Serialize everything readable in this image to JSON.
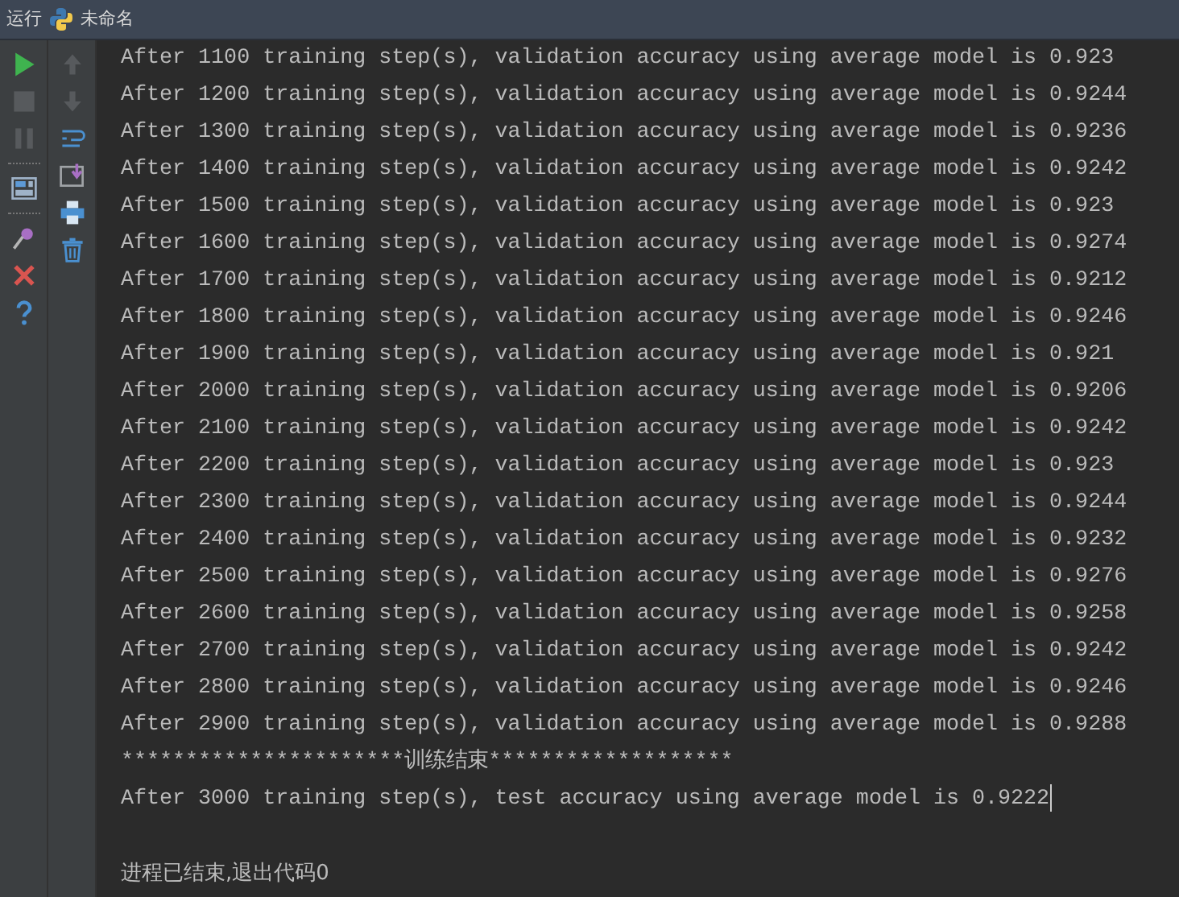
{
  "title_bar": {
    "label": "运行",
    "config_name": "未命名"
  },
  "toolbar_left": [
    {
      "kind": "run",
      "disabled": false
    },
    {
      "kind": "stop",
      "disabled": true
    },
    {
      "kind": "pause",
      "disabled": true
    },
    {
      "kind": "sep"
    },
    {
      "kind": "layout",
      "disabled": false
    },
    {
      "kind": "sep"
    },
    {
      "kind": "pin",
      "disabled": false
    },
    {
      "kind": "close",
      "disabled": false
    },
    {
      "kind": "help",
      "disabled": false
    }
  ],
  "toolbar_right": [
    {
      "kind": "up",
      "disabled": true
    },
    {
      "kind": "down",
      "disabled": true
    },
    {
      "kind": "wrap",
      "disabled": false
    },
    {
      "kind": "scroll-end",
      "disabled": false
    },
    {
      "kind": "print",
      "disabled": false
    },
    {
      "kind": "trash",
      "disabled": false
    }
  ],
  "console": {
    "lines": [
      "After 1100 training step(s), validation accuracy using average model is 0.923",
      "After 1200 training step(s), validation accuracy using average model is 0.9244",
      "After 1300 training step(s), validation accuracy using average model is 0.9236",
      "After 1400 training step(s), validation accuracy using average model is 0.9242",
      "After 1500 training step(s), validation accuracy using average model is 0.923",
      "After 1600 training step(s), validation accuracy using average model is 0.9274",
      "After 1700 training step(s), validation accuracy using average model is 0.9212",
      "After 1800 training step(s), validation accuracy using average model is 0.9246",
      "After 1900 training step(s), validation accuracy using average model is 0.921",
      "After 2000 training step(s), validation accuracy using average model is 0.9206",
      "After 2100 training step(s), validation accuracy using average model is 0.9242",
      "After 2200 training step(s), validation accuracy using average model is 0.923",
      "After 2300 training step(s), validation accuracy using average model is 0.9244",
      "After 2400 training step(s), validation accuracy using average model is 0.9232",
      "After 2500 training step(s), validation accuracy using average model is 0.9276",
      "After 2600 training step(s), validation accuracy using average model is 0.9258",
      "After 2700 training step(s), validation accuracy using average model is 0.9242",
      "After 2800 training step(s), validation accuracy using average model is 0.9246",
      "After 2900 training step(s), validation accuracy using average model is 0.9288",
      "**********************训练结束*******************",
      "After 3000 training step(s), test accuracy using average model is 0.9222"
    ],
    "exit_message": "进程已结束,退出代码0"
  }
}
